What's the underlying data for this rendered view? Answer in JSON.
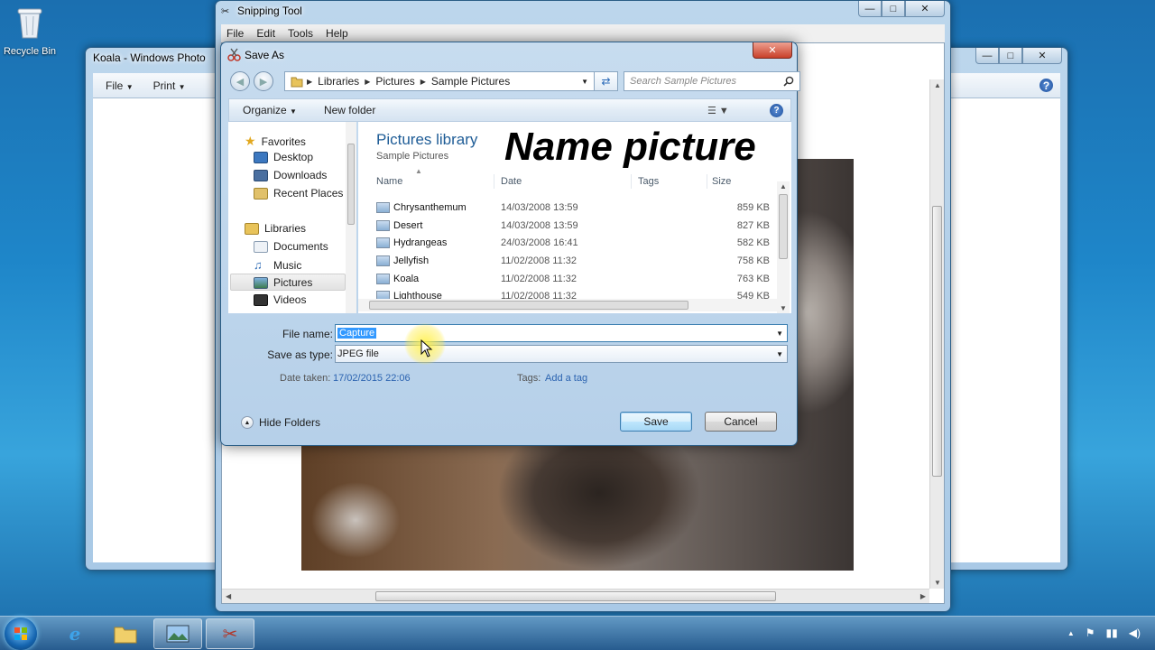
{
  "desktop": {
    "recycle_bin_label": "Recycle Bin"
  },
  "koala_window": {
    "title": "Koala - Windows Photo",
    "menu": {
      "file": "File",
      "print": "Print"
    }
  },
  "snipping_tool": {
    "title": "Snipping Tool",
    "menu": [
      "File",
      "Edit",
      "Tools",
      "Help"
    ]
  },
  "dialog": {
    "title": "Save As",
    "address": {
      "crumbs": [
        "Libraries",
        "Pictures",
        "Sample Pictures"
      ]
    },
    "search_placeholder": "Search Sample Pictures",
    "toolbar": {
      "organize": "Organize",
      "new_folder": "New folder"
    },
    "nav": {
      "favorites": "Favorites",
      "desktop": "Desktop",
      "downloads": "Downloads",
      "recent_places": "Recent Places",
      "libraries": "Libraries",
      "documents": "Documents",
      "music": "Music",
      "pictures": "Pictures",
      "videos": "Videos"
    },
    "library_title": "Pictures library",
    "library_subtitle": "Sample Pictures",
    "overlay_caption": "Name picture",
    "columns": {
      "name": "Name",
      "date": "Date",
      "tags": "Tags",
      "size": "Size"
    },
    "files": [
      {
        "name": "Chrysanthemum",
        "date": "14/03/2008 13:59",
        "size": "859 KB"
      },
      {
        "name": "Desert",
        "date": "14/03/2008 13:59",
        "size": "827 KB"
      },
      {
        "name": "Hydrangeas",
        "date": "24/03/2008 16:41",
        "size": "582 KB"
      },
      {
        "name": "Jellyfish",
        "date": "11/02/2008 11:32",
        "size": "758 KB"
      },
      {
        "name": "Koala",
        "date": "11/02/2008 11:32",
        "size": "763 KB"
      },
      {
        "name": "Lighthouse",
        "date": "11/02/2008 11:32",
        "size": "549 KB"
      }
    ],
    "file_name_label": "File name:",
    "file_name_value": "Capture",
    "save_type_label": "Save as type:",
    "save_type_value": "JPEG file",
    "date_taken_label": "Date taken:",
    "date_taken_value": "17/02/2015 22:06",
    "tags_label": "Tags:",
    "tags_value": "Add a tag",
    "hide_folders": "Hide Folders",
    "save_button": "Save",
    "cancel_button": "Cancel"
  },
  "colors": {
    "accent": "#1e5c96",
    "link": "#2b63b0",
    "selection": "#3399ff"
  }
}
